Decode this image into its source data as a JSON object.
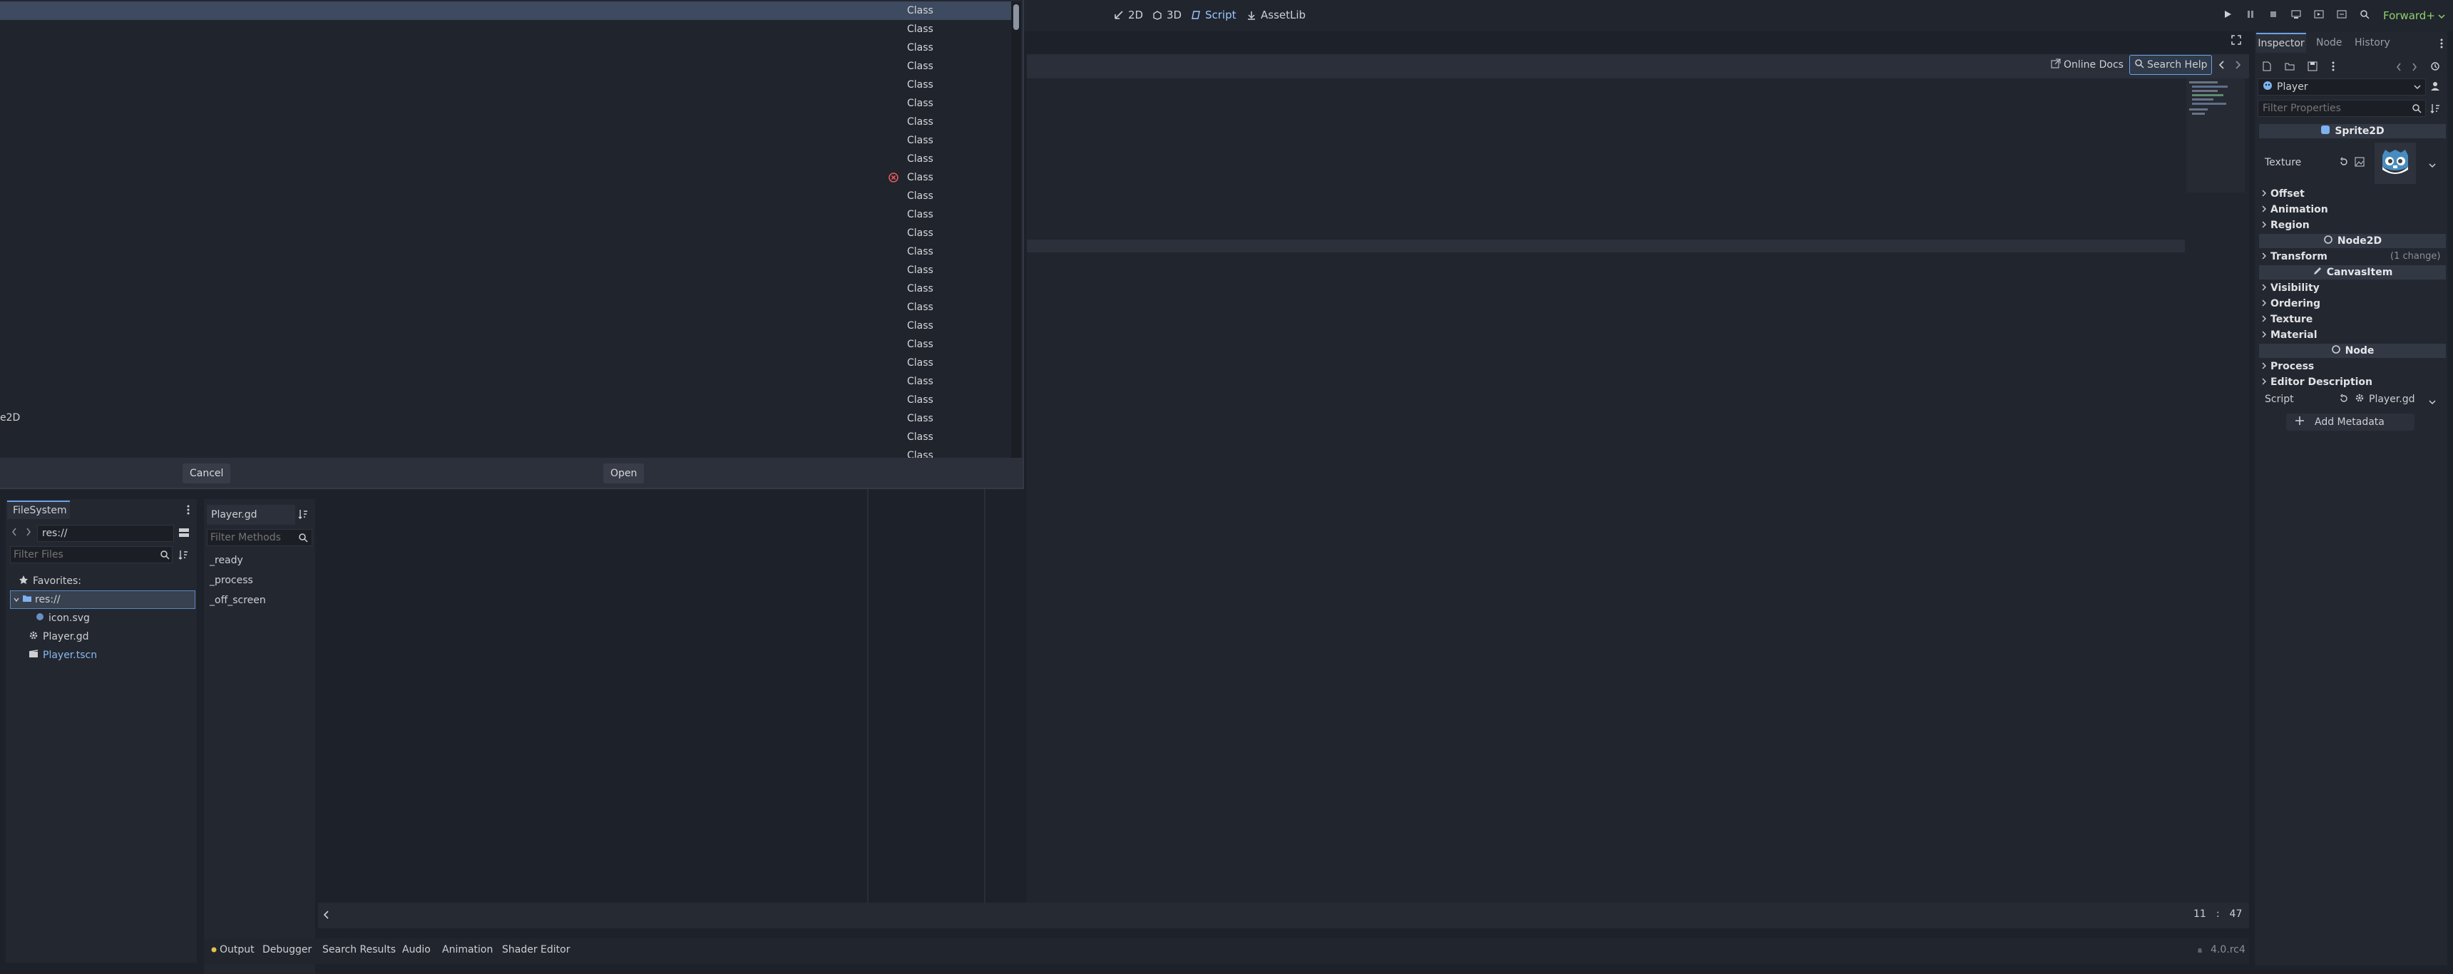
{
  "workspace_tabs": [
    {
      "label": "2D",
      "icon": "2d-icon"
    },
    {
      "label": "3D",
      "icon": "3d-icon"
    },
    {
      "label": "Script",
      "icon": "script-icon"
    },
    {
      "label": "AssetLib",
      "icon": "assetlib-icon"
    }
  ],
  "renderer": "Forward+",
  "editor_toolbar": {
    "online_docs": "Online Docs",
    "search_help": "Search Help"
  },
  "status": {
    "line": "11",
    "sep": ":",
    "col": "47"
  },
  "version": "4.0.rc4",
  "dialog": {
    "items": [
      "Class",
      "Class",
      "Class",
      "Class",
      "Class",
      "Class",
      "Class",
      "Class",
      "Class",
      "Class",
      "Class",
      "Class",
      "Class",
      "Class",
      "Class",
      "Class",
      "Class",
      "Class",
      "Class",
      "Class",
      "Class",
      "Class",
      "Class",
      "Class",
      "Class"
    ],
    "error_item_index": 9,
    "left_fragment": "e2D",
    "cancel": "Cancel",
    "open": "Open"
  },
  "filesystem": {
    "title": "FileSystem",
    "path": "res://",
    "filter_placeholder": "Filter Files",
    "favorites": "Favorites:",
    "root": "res://",
    "files": [
      "icon.svg",
      "Player.gd",
      "Player.tscn"
    ]
  },
  "methods": {
    "script_name": "Player.gd",
    "filter_placeholder": "Filter Methods",
    "items": [
      "_ready",
      "_process",
      "_off_screen"
    ]
  },
  "inspector": {
    "tabs": [
      "Inspector",
      "Node",
      "History"
    ],
    "object": "Player",
    "filter_placeholder": "Filter Properties",
    "sprite_section": "Sprite2D",
    "texture_label": "Texture",
    "sprite_groups": [
      "Offset",
      "Animation",
      "Region"
    ],
    "node2d_section": "Node2D",
    "transform": "Transform",
    "transform_note": "(1 change)",
    "canvas_section": "CanvasItem",
    "canvas_groups": [
      "Visibility",
      "Ordering",
      "Texture",
      "Material"
    ],
    "node_section": "Node",
    "node_groups": [
      "Process",
      "Editor Description"
    ],
    "script_label": "Script",
    "script_value": "Player.gd",
    "add_metadata": "Add Metadata"
  },
  "bottom_tabs": [
    "Output",
    "Debugger",
    "Search Results",
    "Audio",
    "Animation",
    "Shader Editor"
  ]
}
